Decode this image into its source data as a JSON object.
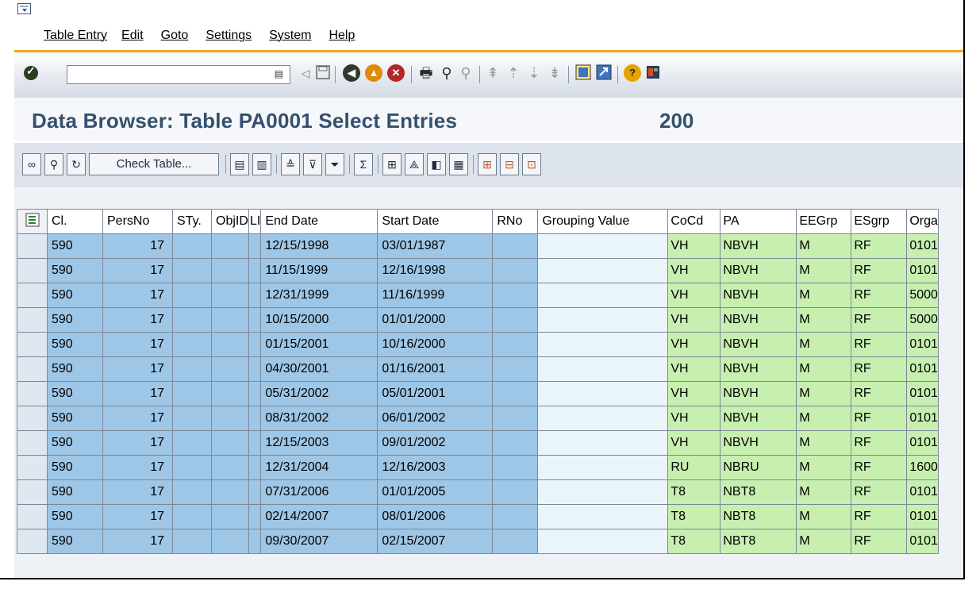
{
  "menu": [
    "Table Entry",
    "Edit",
    "Goto",
    "Settings",
    "System",
    "Help"
  ],
  "command_field": {
    "value": "",
    "placeholder": ""
  },
  "title": "Data Browser: Table PA0001 Select Entries",
  "entry_count": "200",
  "toolbar2": {
    "check_table_label": "Check Table..."
  },
  "colors": {
    "key_columns": "#9ec6e6",
    "value_columns": "#c7efaf",
    "title": "#34506e",
    "toolbar_accent": "#f5a623"
  },
  "table": {
    "headers": [
      "Cl.",
      "PersNo",
      "STy.",
      "ObjID",
      "LI",
      "End Date",
      "Start Date",
      "RNo",
      "Grouping Value",
      "CoCd",
      "PA",
      "EEGrp",
      "ESgrp",
      "Orga"
    ],
    "rows": [
      [
        "590",
        "17",
        "",
        "",
        "",
        "12/15/1998",
        "03/01/1987",
        "",
        "",
        "VH",
        "NBVH",
        "M",
        "RF",
        "0101"
      ],
      [
        "590",
        "17",
        "",
        "",
        "",
        "11/15/1999",
        "12/16/1998",
        "",
        "",
        "VH",
        "NBVH",
        "M",
        "RF",
        "0101"
      ],
      [
        "590",
        "17",
        "",
        "",
        "",
        "12/31/1999",
        "11/16/1999",
        "",
        "",
        "VH",
        "NBVH",
        "M",
        "RF",
        "5000"
      ],
      [
        "590",
        "17",
        "",
        "",
        "",
        "10/15/2000",
        "01/01/2000",
        "",
        "",
        "VH",
        "NBVH",
        "M",
        "RF",
        "5000"
      ],
      [
        "590",
        "17",
        "",
        "",
        "",
        "01/15/2001",
        "10/16/2000",
        "",
        "",
        "VH",
        "NBVH",
        "M",
        "RF",
        "0101"
      ],
      [
        "590",
        "17",
        "",
        "",
        "",
        "04/30/2001",
        "01/16/2001",
        "",
        "",
        "VH",
        "NBVH",
        "M",
        "RF",
        "0101"
      ],
      [
        "590",
        "17",
        "",
        "",
        "",
        "05/31/2002",
        "05/01/2001",
        "",
        "",
        "VH",
        "NBVH",
        "M",
        "RF",
        "0101"
      ],
      [
        "590",
        "17",
        "",
        "",
        "",
        "08/31/2002",
        "06/01/2002",
        "",
        "",
        "VH",
        "NBVH",
        "M",
        "RF",
        "0101"
      ],
      [
        "590",
        "17",
        "",
        "",
        "",
        "12/15/2003",
        "09/01/2002",
        "",
        "",
        "VH",
        "NBVH",
        "M",
        "RF",
        "0101"
      ],
      [
        "590",
        "17",
        "",
        "",
        "",
        "12/31/2004",
        "12/16/2003",
        "",
        "",
        "RU",
        "NBRU",
        "M",
        "RF",
        "1600"
      ],
      [
        "590",
        "17",
        "",
        "",
        "",
        "07/31/2006",
        "01/01/2005",
        "",
        "",
        "T8",
        "NBT8",
        "M",
        "RF",
        "0101"
      ],
      [
        "590",
        "17",
        "",
        "",
        "",
        "02/14/2007",
        "08/01/2006",
        "",
        "",
        "T8",
        "NBT8",
        "M",
        "RF",
        "0101"
      ],
      [
        "590",
        "17",
        "",
        "",
        "",
        "09/30/2007",
        "02/15/2007",
        "",
        "",
        "T8",
        "NBT8",
        "M",
        "RF",
        "0101"
      ]
    ]
  }
}
